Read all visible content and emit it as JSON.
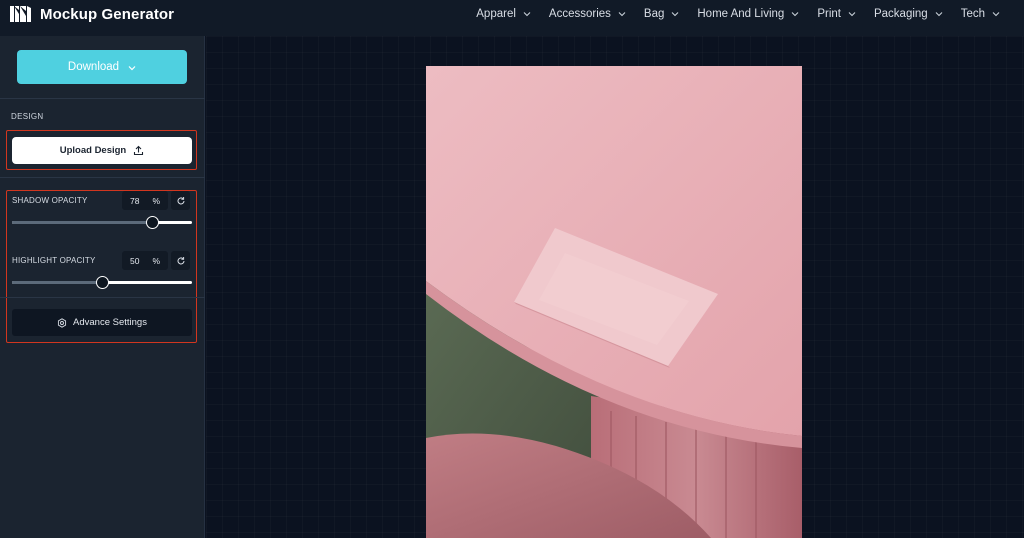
{
  "app": {
    "title": "Mockup Generator",
    "logo_icon": "mockup-generator-logo-icon"
  },
  "nav": {
    "items": [
      {
        "label": "Apparel"
      },
      {
        "label": "Accessories"
      },
      {
        "label": "Bag"
      },
      {
        "label": "Home And Living"
      },
      {
        "label": "Print"
      },
      {
        "label": "Packaging"
      },
      {
        "label": "Tech"
      }
    ]
  },
  "sidebar": {
    "download_label": "Download",
    "design_section_label": "DESIGN",
    "upload_label": "Upload Design",
    "shadow": {
      "label": "SHADOW OPACITY",
      "value": "78",
      "unit": "%",
      "level": 0.78
    },
    "highlight": {
      "label": "HIGHLIGHT OPACITY",
      "value": "50",
      "unit": "%",
      "level": 0.5
    },
    "advance_label": "Advance Settings"
  },
  "colors": {
    "accent": "#4fd0e0",
    "highlight_outline": "#d2361f",
    "background": "#0b1220",
    "panel": "#1b2430"
  },
  "icons": {
    "download_chevron": "chevron-down-icon",
    "upload": "upload-icon",
    "reset": "reset-icon",
    "advance": "gear-icon"
  },
  "preview": {
    "description_hidden": true
  }
}
